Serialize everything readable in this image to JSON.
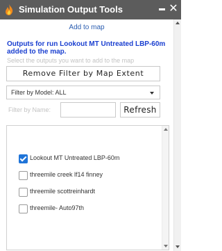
{
  "window": {
    "title": "Simulation Output Tools",
    "minimize_icon": "minimize-icon",
    "close_icon": "close-icon",
    "app_icon": "flame-icon",
    "close_glyph": "✕"
  },
  "panel": {
    "add_to_map_link": "Add to map",
    "outputs_message": "Outputs for run Lookout MT Untreated LBP-60m added to the map.",
    "instructions": "Select the outputs you want to add to the map",
    "remove_filter_button": "Remove Filter by Map Extent",
    "filter_model": {
      "selected": "Filter by Model: ALL"
    },
    "filter_name": {
      "label": "Filter by Name:",
      "value": "",
      "placeholder": ""
    },
    "refresh_button": "Refresh",
    "outputs": [
      {
        "label": "Lookout MT Untreated LBP-60m",
        "checked": true
      },
      {
        "label": "threemile creek lf14 finney",
        "checked": false
      },
      {
        "label": "threemile scottreinhardt",
        "checked": false
      },
      {
        "label": "threemile- Auto97th",
        "checked": false
      }
    ]
  },
  "colors": {
    "titlebar_bg": "#5c5c5c",
    "link": "#2a5db0",
    "message": "#1a3fd0",
    "checkbox_checked": "#1f74d8",
    "hint_text": "#c3c3c3"
  }
}
